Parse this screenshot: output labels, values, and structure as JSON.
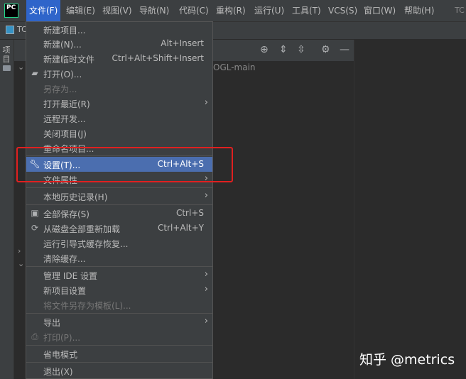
{
  "menubar": {
    "logo_text": "PC",
    "items": [
      "文件(F)",
      "编辑(E)",
      "视图(V)",
      "导航(N)",
      "代码(C)",
      "重构(R)",
      "运行(U)",
      "工具(T)",
      "VCS(S)",
      "窗口(W)",
      "帮助(H)"
    ],
    "title_fragment": "TC"
  },
  "navbar": {
    "project_label": "TC"
  },
  "left_strip": {
    "label": "项目"
  },
  "project_panel": {
    "path_fragment": "OGL-main"
  },
  "file_menu": {
    "items": [
      {
        "label": "新建项目..."
      },
      {
        "label": "新建(N)...",
        "shortcut": "Alt+Insert"
      },
      {
        "label": "新建临时文件",
        "shortcut": "Ctrl+Alt+Shift+Insert"
      },
      {
        "label": "打开(O)..."
      },
      {
        "label": "另存为..."
      },
      {
        "label": "打开最近(R)"
      },
      {
        "label": "远程开发..."
      },
      {
        "label": "关闭项目(J)"
      },
      {
        "label": "重命名项目..."
      },
      {
        "label": "设置(T)...",
        "shortcut": "Ctrl+Alt+S"
      },
      {
        "label": "文件属性"
      },
      {
        "label": "本地历史记录(H)"
      },
      {
        "label": "全部保存(S)",
        "shortcut": "Ctrl+S"
      },
      {
        "label": "从磁盘全部重新加载",
        "shortcut": "Ctrl+Alt+Y"
      },
      {
        "label": "运行引导式缓存恢复..."
      },
      {
        "label": "清除缓存..."
      },
      {
        "label": "管理 IDE 设置"
      },
      {
        "label": "新项目设置"
      },
      {
        "label": "将文件另存为模板(L)..."
      },
      {
        "label": "导出"
      },
      {
        "label": "打印(P)..."
      },
      {
        "label": "省电模式"
      },
      {
        "label": "退出(X)"
      }
    ]
  },
  "watermark": "知乎 @metrics",
  "colors": {
    "menu_bg": "#3c3f41",
    "highlight": "#4b6eaf",
    "active_menu": "#2f65ca",
    "annotation": "#e02020"
  }
}
